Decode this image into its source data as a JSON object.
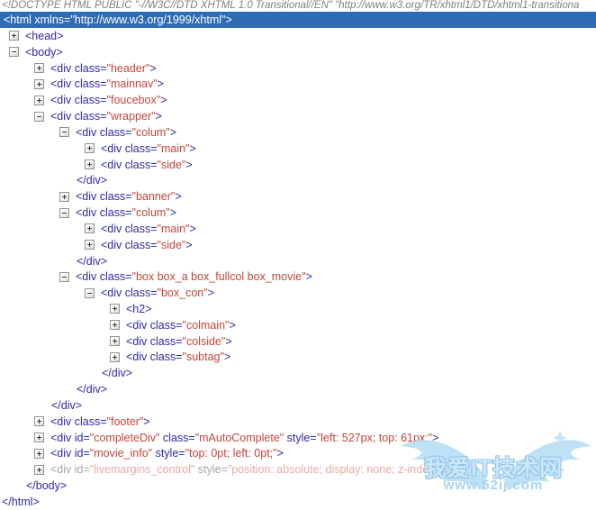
{
  "colors": {
    "tag": "#2A2AA8",
    "value": "#C5443A",
    "selected_bg": "#2E6CB5",
    "selected_text": "#FFFFFF",
    "doctype": "#808080",
    "faded_tag": "#A6A6A6",
    "faded_value": "#E4ABA2",
    "watermark_blue": "#A9D4F1"
  },
  "doctype_line": "<!DOCTYPE HTML PUBLIC \"-//W3C//DTD XHTML 1.0 Transitional//EN\" \"http://www.w3.org/TR/xhtml1/DTD/xhtml1-transitiona",
  "selected_node": {
    "text": "<html xmlns=\"http://www.w3.org/1999/xhtml\">"
  },
  "tree": {
    "rows": [
      {
        "d": 1,
        "toggle": "plus",
        "name": "node-head",
        "segments": [
          {
            "c": "tag",
            "t": "<head>"
          }
        ]
      },
      {
        "d": 1,
        "toggle": "minus",
        "name": "node-body",
        "segments": [
          {
            "c": "tag",
            "t": "<body>"
          }
        ]
      },
      {
        "d": 2,
        "toggle": "plus",
        "name": "node-div-header",
        "segments": [
          {
            "c": "tag",
            "t": "<div class="
          },
          {
            "c": "val",
            "t": "\"header\""
          },
          {
            "c": "tag",
            "t": ">"
          }
        ]
      },
      {
        "d": 2,
        "toggle": "plus",
        "name": "node-div-mainnav",
        "segments": [
          {
            "c": "tag",
            "t": "<div class="
          },
          {
            "c": "val",
            "t": "\"mainnav\""
          },
          {
            "c": "tag",
            "t": ">"
          }
        ]
      },
      {
        "d": 2,
        "toggle": "plus",
        "name": "node-div-foucebox",
        "segments": [
          {
            "c": "tag",
            "t": "<div class="
          },
          {
            "c": "val",
            "t": "\"foucebox\""
          },
          {
            "c": "tag",
            "t": ">"
          }
        ]
      },
      {
        "d": 2,
        "toggle": "minus",
        "name": "node-div-wrapper",
        "segments": [
          {
            "c": "tag",
            "t": "<div class="
          },
          {
            "c": "val",
            "t": "\"wrapper\""
          },
          {
            "c": "tag",
            "t": ">"
          }
        ]
      },
      {
        "d": 3,
        "toggle": "minus",
        "name": "node-div-colum",
        "segments": [
          {
            "c": "tag",
            "t": "<div class="
          },
          {
            "c": "val",
            "t": "\"colum\""
          },
          {
            "c": "tag",
            "t": ">"
          }
        ]
      },
      {
        "d": 4,
        "toggle": "plus",
        "name": "node-div-main",
        "segments": [
          {
            "c": "tag",
            "t": "<div class="
          },
          {
            "c": "val",
            "t": "\"main\""
          },
          {
            "c": "tag",
            "t": ">"
          }
        ]
      },
      {
        "d": 4,
        "toggle": "plus",
        "name": "node-div-side",
        "segments": [
          {
            "c": "tag",
            "t": "<div class="
          },
          {
            "c": "val",
            "t": "\"side\""
          },
          {
            "c": "tag",
            "t": ">"
          }
        ]
      },
      {
        "d": 3,
        "closing": true,
        "name": "closing-div-colum",
        "segments": [
          {
            "c": "tag",
            "t": "</div>"
          }
        ]
      },
      {
        "d": 3,
        "toggle": "plus",
        "name": "node-div-banner",
        "segments": [
          {
            "c": "tag",
            "t": "<div class="
          },
          {
            "c": "val",
            "t": "\"banner\""
          },
          {
            "c": "tag",
            "t": ">"
          }
        ]
      },
      {
        "d": 3,
        "toggle": "minus",
        "name": "node-div-colum-2",
        "segments": [
          {
            "c": "tag",
            "t": "<div class="
          },
          {
            "c": "val",
            "t": "\"colum\""
          },
          {
            "c": "tag",
            "t": ">"
          }
        ]
      },
      {
        "d": 4,
        "toggle": "plus",
        "name": "node-div-main-2",
        "segments": [
          {
            "c": "tag",
            "t": "<div class="
          },
          {
            "c": "val",
            "t": "\"main\""
          },
          {
            "c": "tag",
            "t": ">"
          }
        ]
      },
      {
        "d": 4,
        "toggle": "plus",
        "name": "node-div-side-2",
        "segments": [
          {
            "c": "tag",
            "t": "<div class="
          },
          {
            "c": "val",
            "t": "\"side\""
          },
          {
            "c": "tag",
            "t": ">"
          }
        ]
      },
      {
        "d": 3,
        "closing": true,
        "name": "closing-div-colum-2",
        "segments": [
          {
            "c": "tag",
            "t": "</div>"
          }
        ]
      },
      {
        "d": 3,
        "toggle": "minus",
        "name": "node-div-box-movie",
        "segments": [
          {
            "c": "tag",
            "t": "<div class="
          },
          {
            "c": "val",
            "t": "\"box box_a box_fullcol box_movie\""
          },
          {
            "c": "tag",
            "t": ">"
          }
        ]
      },
      {
        "d": 4,
        "toggle": "minus",
        "name": "node-div-box-con",
        "segments": [
          {
            "c": "tag",
            "t": "<div class="
          },
          {
            "c": "val",
            "t": "\"box_con\""
          },
          {
            "c": "tag",
            "t": ">"
          }
        ]
      },
      {
        "d": 5,
        "toggle": "plus",
        "name": "node-h2",
        "segments": [
          {
            "c": "tag",
            "t": "<h2>"
          }
        ]
      },
      {
        "d": 5,
        "toggle": "plus",
        "name": "node-div-colmain",
        "segments": [
          {
            "c": "tag",
            "t": "<div class="
          },
          {
            "c": "val",
            "t": "\"colmain\""
          },
          {
            "c": "tag",
            "t": ">"
          }
        ]
      },
      {
        "d": 5,
        "toggle": "plus",
        "name": "node-div-colside",
        "segments": [
          {
            "c": "tag",
            "t": "<div class="
          },
          {
            "c": "val",
            "t": "\"colside\""
          },
          {
            "c": "tag",
            "t": ">"
          }
        ]
      },
      {
        "d": 5,
        "toggle": "plus",
        "name": "node-div-subtag",
        "segments": [
          {
            "c": "tag",
            "t": "<div class="
          },
          {
            "c": "val",
            "t": "\"subtag\""
          },
          {
            "c": "tag",
            "t": ">"
          }
        ]
      },
      {
        "d": 4,
        "closing": true,
        "name": "closing-div-box-con",
        "segments": [
          {
            "c": "tag",
            "t": "</div>"
          }
        ]
      },
      {
        "d": 3,
        "closing": true,
        "name": "closing-div-box",
        "segments": [
          {
            "c": "tag",
            "t": "</div>"
          }
        ]
      },
      {
        "d": 2,
        "closing": true,
        "name": "closing-div-wrapper",
        "segments": [
          {
            "c": "tag",
            "t": "</div>"
          }
        ]
      },
      {
        "d": 2,
        "toggle": "plus",
        "name": "node-div-footer",
        "segments": [
          {
            "c": "tag",
            "t": "<div class="
          },
          {
            "c": "val",
            "t": "\"footer\""
          },
          {
            "c": "tag",
            "t": ">"
          }
        ]
      },
      {
        "d": 2,
        "toggle": "plus",
        "name": "node-div-completediv",
        "segments": [
          {
            "c": "tag",
            "t": "<div id="
          },
          {
            "c": "val",
            "t": "\"completeDiv\""
          },
          {
            "c": "tag",
            "t": " class="
          },
          {
            "c": "val",
            "t": "\"mAutoComplete\""
          },
          {
            "c": "tag",
            "t": " style="
          },
          {
            "c": "val",
            "t": "\"left: 527px; top: 61px;\""
          },
          {
            "c": "tag",
            "t": ">"
          }
        ]
      },
      {
        "d": 2,
        "toggle": "plus",
        "name": "node-div-movie-info",
        "segments": [
          {
            "c": "tag",
            "t": "<div id="
          },
          {
            "c": "val",
            "t": "\"movie_info\""
          },
          {
            "c": "tag",
            "t": " style="
          },
          {
            "c": "val",
            "t": "\"top: 0pt; left: 0pt;\""
          },
          {
            "c": "tag",
            "t": ">"
          }
        ]
      },
      {
        "d": 2,
        "toggle": "plus",
        "faded": true,
        "name": "node-div-livemargins-control",
        "segments": [
          {
            "c": "tag",
            "t": "<div id="
          },
          {
            "c": "val",
            "t": "\"livemargins_control\""
          },
          {
            "c": "tag",
            "t": " style="
          },
          {
            "c": "val",
            "t": "\"position: absolute; display: none; z-index: 9999;\""
          },
          {
            "c": "tag",
            "t": ">"
          }
        ]
      },
      {
        "d": 1,
        "closing": true,
        "name": "closing-body",
        "segments": [
          {
            "c": "tag",
            "t": "</body>"
          }
        ]
      },
      {
        "d": 0,
        "closing": true,
        "name": "closing-html",
        "segments": [
          {
            "c": "tag",
            "t": "</html>"
          }
        ]
      }
    ]
  },
  "watermark": {
    "title": "我爱IT技术网",
    "url": "www.52ij.com"
  }
}
